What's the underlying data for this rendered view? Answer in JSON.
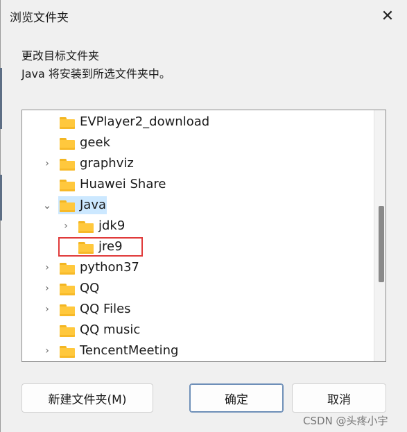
{
  "dialog": {
    "title": "浏览文件夹",
    "close_glyph": "✕"
  },
  "description": {
    "line1": "更改目标文件夹",
    "line2": "Java 将安装到所选文件夹中。"
  },
  "tree": {
    "items": [
      {
        "label": "EVPlayer2_download",
        "expander": "",
        "level": 0
      },
      {
        "label": "geek",
        "expander": "",
        "level": 0
      },
      {
        "label": "graphviz",
        "expander": "›",
        "level": 0
      },
      {
        "label": "Huawei Share",
        "expander": "",
        "level": 0
      },
      {
        "label": "Java",
        "expander": "⌄",
        "level": 0,
        "selected": true
      },
      {
        "label": "jdk9",
        "expander": "›",
        "level": 1
      },
      {
        "label": "jre9",
        "expander": "",
        "level": 1,
        "highlighted": true
      },
      {
        "label": "python37",
        "expander": "›",
        "level": 0
      },
      {
        "label": "QQ",
        "expander": "›",
        "level": 0
      },
      {
        "label": "QQ Files",
        "expander": "›",
        "level": 0
      },
      {
        "label": "QQ music",
        "expander": "",
        "level": 0
      },
      {
        "label": "TencentMeeting",
        "expander": "›",
        "level": 0
      }
    ]
  },
  "buttons": {
    "new_folder": "新建文件夹(M)",
    "ok": "确定",
    "cancel": "取消"
  },
  "watermark": "CSDN @头疼小宇",
  "colors": {
    "folder": "#ffc83d",
    "selection": "#cce8ff",
    "highlight_border": "#e03a3a"
  },
  "icons": {
    "folder": "folder-icon",
    "expand": "chevron-right-icon",
    "collapse": "chevron-down-icon",
    "close": "close-icon"
  }
}
